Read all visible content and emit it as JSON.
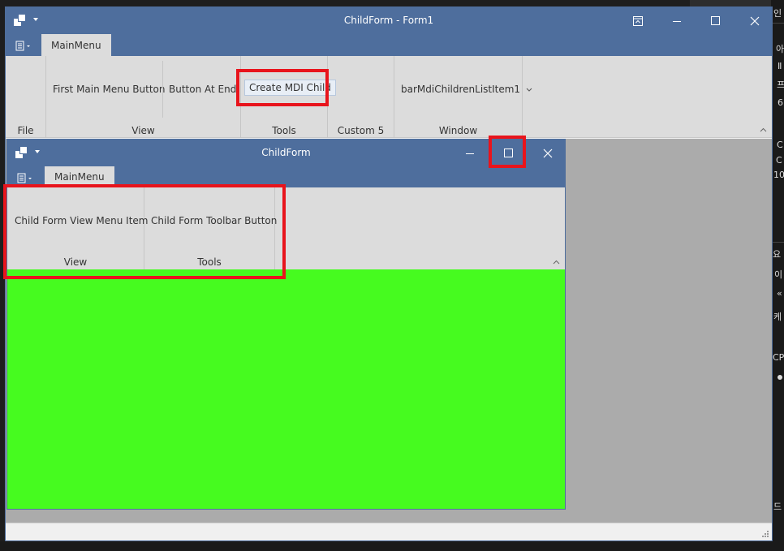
{
  "main_window": {
    "title": "ChildForm - Form1",
    "tab_label": "MainMenu",
    "ribbon": {
      "file_caption": "File",
      "view_caption": "View",
      "tools_caption": "Tools",
      "custom_caption": "Custom 5",
      "window_caption": "Window",
      "first_button": "First Main Menu Button",
      "end_button": "Button At End",
      "create_mdi_button": "Create MDI Child",
      "mdi_list_item": "barMdiChildrenListItem1"
    }
  },
  "child_window": {
    "title": "ChildForm",
    "tab_label": "MainMenu",
    "ribbon": {
      "view_item": "Child Form View Menu Item",
      "toolbar_button": "Child Form Toolbar Button",
      "view_caption": "View",
      "tools_caption": "Tools"
    },
    "content_color": "#46fb1f"
  },
  "background_text": {
    "t1": "인",
    "t2": "아",
    "t3": "Ⅱ",
    "t4": "프",
    "t5": "6",
    "t6": "C",
    "t7": "C",
    "t8": "10",
    "t9": "요",
    "t10": "이",
    "t11": "«",
    "t12": "케",
    "t13": "CP",
    "t14": "드"
  },
  "colors": {
    "title_bar": "#4e6e9d",
    "highlight_border": "#e8141c",
    "ribbon_bg": "#dcdcdc",
    "mdi_bg": "#ababab"
  },
  "icons": [
    "app-icon",
    "app-menu-icon",
    "ribbon-display-options-icon",
    "minimize-icon",
    "maximize-icon",
    "close-icon",
    "collapse-ribbon-icon",
    "size-grip-icon"
  ]
}
